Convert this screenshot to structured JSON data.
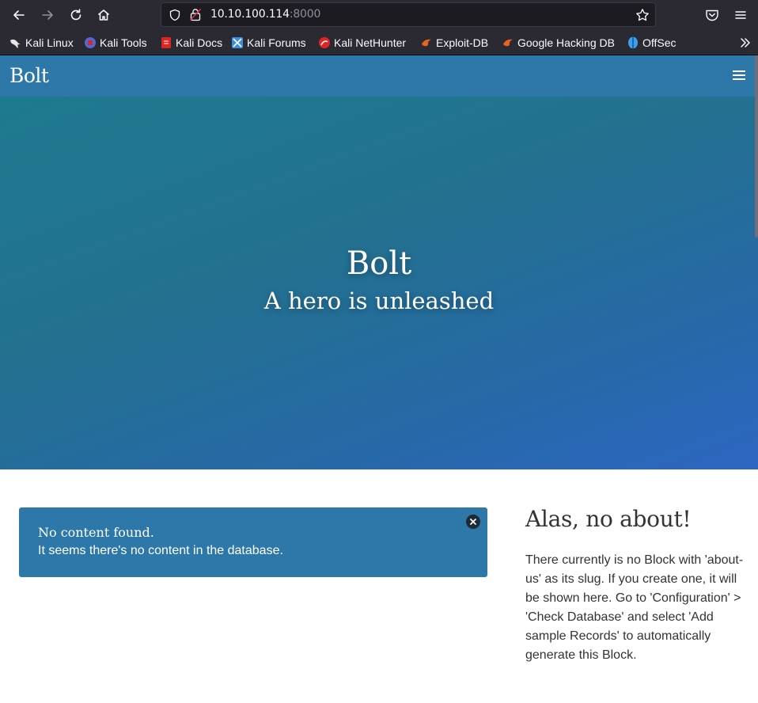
{
  "browser": {
    "url_host": "10.10.100.114",
    "url_port": ":8000",
    "bookmarks": [
      {
        "label": "Kali Linux",
        "color": "#e6e6e6"
      },
      {
        "label": "Kali Tools",
        "color": "#4b6bd8"
      },
      {
        "label": "Kali Docs",
        "color": "#e02424"
      },
      {
        "label": "Kali Forums",
        "color": "#3b8fe0"
      },
      {
        "label": "Kali NetHunter",
        "color": "#e02424"
      },
      {
        "label": "Exploit-DB",
        "color": "#e8641e"
      },
      {
        "label": "Google Hacking DB",
        "color": "#e8641e"
      },
      {
        "label": "OffSec",
        "color": "#3aa0f0"
      }
    ]
  },
  "site": {
    "brand": "Bolt",
    "hero_title": "Bolt",
    "hero_subtitle": "A hero is unleashed",
    "alert": {
      "title": "No content found.",
      "text": "It seems there's no content in the database."
    },
    "about": {
      "heading": "Alas, no about!",
      "text": "There currently is no Block with 'about-us' as its slug. If you create one, it will be shown here. Go to 'Configuration' > 'Check Database' and select 'Add sample Records' to automatically generate this Block."
    }
  },
  "colors": {
    "navbar": "#2d78a8",
    "alert": "#2d78a8",
    "hero_start": "#1e7a8f",
    "hero_end": "#2d66c2"
  }
}
